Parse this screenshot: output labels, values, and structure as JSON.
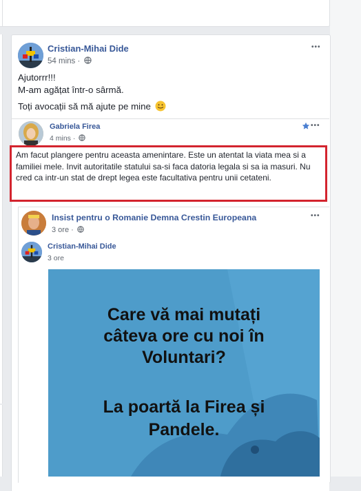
{
  "post": {
    "author": "Cristian-Mihai Dide",
    "time": "54 mins · ",
    "lines": [
      "Ajutorrr!!!",
      "M-am agățat într-o sârmă.",
      "Toți avocații să mă ajute pe mine"
    ],
    "emoji": "smile-emoji",
    "menu": "•••"
  },
  "shared": {
    "author": "Gabriela Firea",
    "time": "4 mins · ",
    "text": "Am facut plangere pentru aceasta amenintare. Este un atentat la viata mea si a familiei mele. Invit autoritatile statului sa-si faca datoria legala si sa ia masuri. Nu cred ca intr-un stat de drept legea este facultativa pentru unii cetateni.",
    "menu": "•••"
  },
  "shared2": {
    "author": "Insist pentru o Romanie Demna Crestin Europeana",
    "time": "3 ore · ",
    "menu": "•••"
  },
  "inner": {
    "author": "Cristian-Mihai Dide",
    "time": "3 ore"
  },
  "image": {
    "line1": "Care vă mai mutați",
    "line2": "câteva ore cu noi în",
    "line3": "Voluntari?",
    "line4": "La poartă la Firea și",
    "line5": "Pandele."
  },
  "colors": {
    "link": "#385898",
    "highlight": "#d3242e",
    "image_bg": "#4e9cca"
  }
}
